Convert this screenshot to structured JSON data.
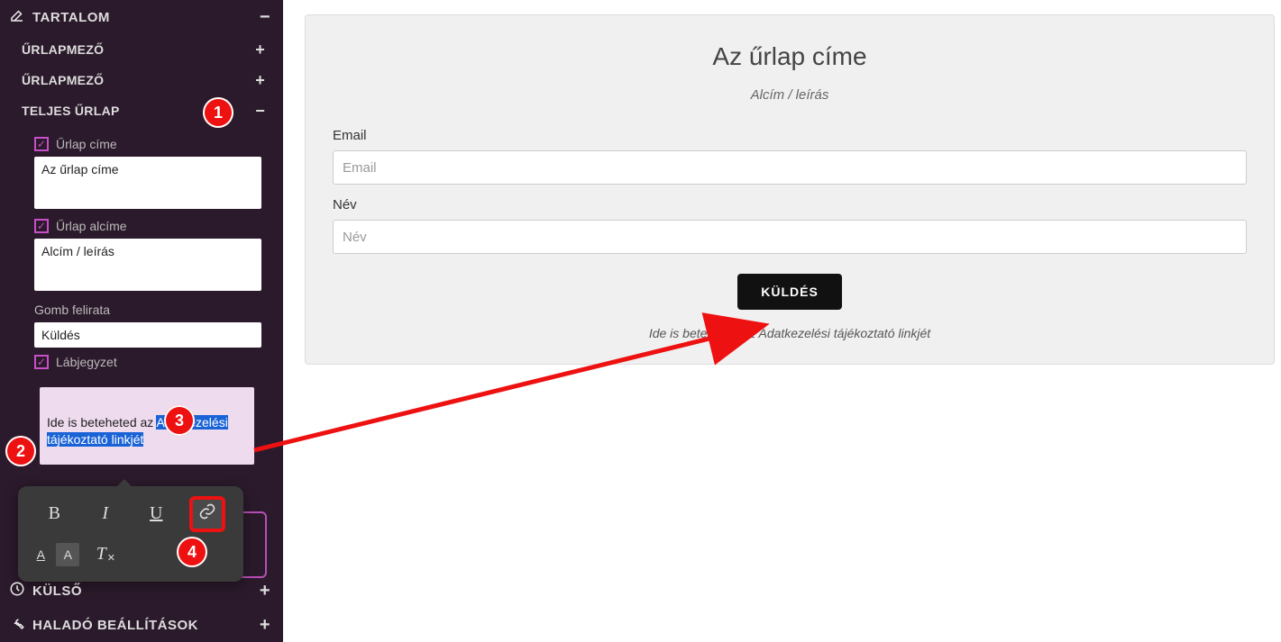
{
  "sidebar": {
    "sections": {
      "content": {
        "label": "TARTALOM",
        "icon": "edit-icon",
        "expanded": true
      },
      "external": {
        "label": "KÜLSŐ",
        "icon": "clock-icon",
        "expanded": false
      },
      "advanced": {
        "label": "HALADÓ BEÁLLÍTÁSOK",
        "icon": "wrench-icon",
        "expanded": false
      }
    },
    "content_items": [
      {
        "label": "ŰRLAPMEZŐ",
        "expanded": false
      },
      {
        "label": "ŰRLAPMEZŐ",
        "expanded": false
      },
      {
        "label": "TELJES ŰRLAP",
        "expanded": true
      }
    ],
    "full_form": {
      "title_checkbox_label": "Űrlap címe",
      "title_value": "Az űrlap címe",
      "subtitle_checkbox_label": "Űrlap alcíme",
      "subtitle_value": "Alcím / leírás",
      "button_label_caption": "Gomb felirata",
      "button_label_value": "Küldés",
      "footnote_checkbox_label": "Lábjegyzet",
      "footnote_text_plain": "Ide is beteheted az Adatkezelési tájékoztató linkjét",
      "footnote_text_prefix": "Ide is beteheted az ",
      "footnote_text_selected": "Adatkezelési tájékoztató linkjét"
    },
    "toolbar": {
      "bold": "B",
      "italic": "I",
      "underline": "U",
      "link": "link",
      "textcolor": "A",
      "bgcolor": "A",
      "clear": "T",
      "clear_sub": "✕"
    }
  },
  "form": {
    "title": "Az űrlap címe",
    "subtitle": "Alcím / leírás",
    "fields": [
      {
        "label": "Email",
        "placeholder": "Email"
      },
      {
        "label": "Név",
        "placeholder": "Név"
      }
    ],
    "submit_label": "KÜLDÉS",
    "footnote": "Ide is beteheted az Adatkezelési tájékoztató linkjét"
  },
  "annotations": {
    "badges": [
      "1",
      "2",
      "3",
      "4"
    ]
  }
}
